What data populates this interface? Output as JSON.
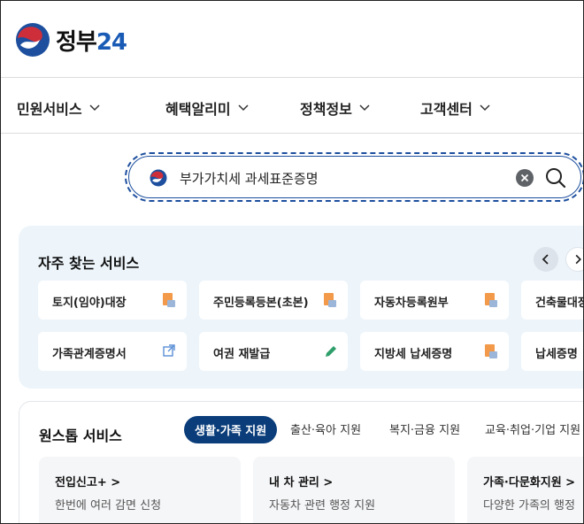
{
  "header": {
    "logo_text": "정부",
    "logo_number": "24"
  },
  "nav": [
    {
      "label": "민원서비스"
    },
    {
      "label": "혜택알리미"
    },
    {
      "label": "정책정보"
    },
    {
      "label": "고객센터"
    }
  ],
  "search": {
    "value": "부가가치세 과세표준증명",
    "clear_icon": "close-icon",
    "search_icon": "search-icon"
  },
  "frequent": {
    "title": "자주 찾는 서비스",
    "items": [
      {
        "label": "토지(임야)대장",
        "icon": "document-icon"
      },
      {
        "label": "주민등록등본(초본)",
        "icon": "document-icon"
      },
      {
        "label": "자동차등록원부",
        "icon": "document-icon"
      },
      {
        "label": "건축물대장",
        "icon": "document-icon"
      },
      {
        "label": "가족관계증명서",
        "icon": "external-link-icon"
      },
      {
        "label": "여권 재발급",
        "icon": "pencil-icon"
      },
      {
        "label": "지방세 납세증명",
        "icon": "document-icon"
      },
      {
        "label": "납세증명",
        "icon": "document-icon"
      }
    ]
  },
  "onestop": {
    "title": "원스톱 서비스",
    "tabs": [
      {
        "label": "생활·가족 지원",
        "active": true
      },
      {
        "label": "출산·육아 지원"
      },
      {
        "label": "복지·금융 지원"
      },
      {
        "label": "교육·취업·기업 지원"
      }
    ],
    "cards": [
      {
        "title": "전입신고+ >",
        "desc": "한번에 여러 감면 신청"
      },
      {
        "title": "내 차 관리 >",
        "desc": "자동차 관련 행정 지원"
      },
      {
        "title": "가족·다문화지원 >",
        "desc": "다양한 가족의 행정"
      }
    ]
  },
  "colors": {
    "brand_blue": "#1d4f9e",
    "brand_red": "#cd2e3a",
    "active_tab": "#0a3d7a",
    "panel_bg": "#edf5fb"
  }
}
